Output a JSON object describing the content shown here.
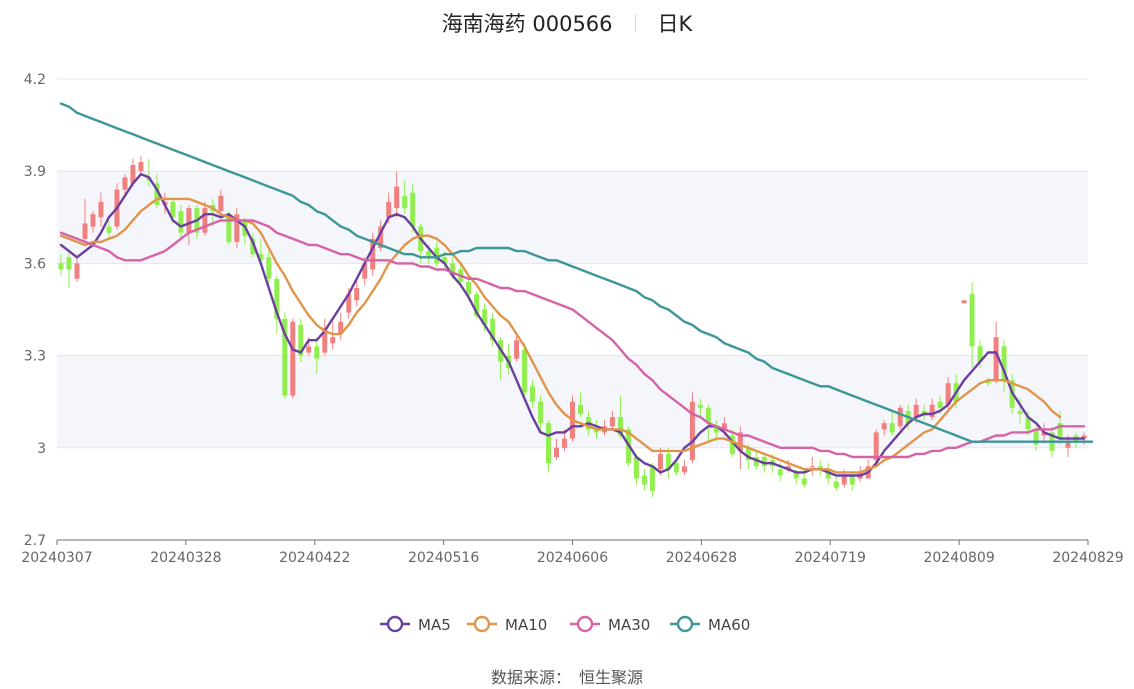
{
  "title": {
    "name": "海南海药 000566",
    "period": "日K"
  },
  "source": {
    "label": "数据来源：",
    "value": "恒生聚源"
  },
  "colors": {
    "up": "#f08080",
    "down": "#90ee50",
    "MA5": "#6a3fa0",
    "MA10": "#e0954a",
    "MA30": "#d663a8",
    "MA60": "#3d9698",
    "bandA": "#f4f6fb",
    "bandB": "#ffffff",
    "grid": "#e0e6f1"
  },
  "chart_data": {
    "type": "candlestick",
    "title": "海南海药 000566",
    "subtitle": "日K",
    "ylim": [
      2.7,
      4.2
    ],
    "yticks": [
      "2.7",
      "3",
      "3.3",
      "3.6",
      "3.9",
      "4.2"
    ],
    "xticks": [
      "20240307",
      "20240328",
      "20240422",
      "20240516",
      "20240606",
      "20240628",
      "20240719",
      "20240809",
      "20240829"
    ],
    "legend": [
      "MA5",
      "MA10",
      "MA30",
      "MA60"
    ],
    "legend_position": "bottom-center",
    "candles_ohlc": [
      [
        3.6,
        3.58,
        3.63,
        3.56
      ],
      [
        3.62,
        3.58,
        3.64,
        3.52
      ],
      [
        3.55,
        3.6,
        3.62,
        3.54
      ],
      [
        3.68,
        3.73,
        3.81,
        3.67
      ],
      [
        3.72,
        3.76,
        3.77,
        3.7
      ],
      [
        3.75,
        3.8,
        3.83,
        3.72
      ],
      [
        3.72,
        3.7,
        3.74,
        3.68
      ],
      [
        3.72,
        3.84,
        3.86,
        3.71
      ],
      [
        3.84,
        3.88,
        3.89,
        3.82
      ],
      [
        3.86,
        3.92,
        3.94,
        3.85
      ],
      [
        3.9,
        3.93,
        3.95,
        3.89
      ],
      [
        3.88,
        3.87,
        3.94,
        3.85
      ],
      [
        3.86,
        3.79,
        3.89,
        3.78
      ],
      [
        3.79,
        3.8,
        3.83,
        3.76
      ],
      [
        3.8,
        3.75,
        3.81,
        3.73
      ],
      [
        3.77,
        3.7,
        3.79,
        3.68
      ],
      [
        3.7,
        3.78,
        3.79,
        3.66
      ],
      [
        3.78,
        3.7,
        3.79,
        3.68
      ],
      [
        3.7,
        3.78,
        3.8,
        3.69
      ],
      [
        3.79,
        3.77,
        3.81,
        3.72
      ],
      [
        3.77,
        3.82,
        3.84,
        3.75
      ],
      [
        3.75,
        3.67,
        3.77,
        3.66
      ],
      [
        3.67,
        3.76,
        3.78,
        3.65
      ],
      [
        3.74,
        3.69,
        3.75,
        3.66
      ],
      [
        3.68,
        3.63,
        3.7,
        3.62
      ],
      [
        3.63,
        3.61,
        3.68,
        3.59
      ],
      [
        3.62,
        3.55,
        3.64,
        3.53
      ],
      [
        3.55,
        3.42,
        3.56,
        3.37
      ],
      [
        3.42,
        3.17,
        3.44,
        3.16
      ],
      [
        3.17,
        3.41,
        3.42,
        3.16
      ],
      [
        3.4,
        3.3,
        3.42,
        3.28
      ],
      [
        3.31,
        3.33,
        3.36,
        3.3
      ],
      [
        3.33,
        3.29,
        3.36,
        3.24
      ],
      [
        3.31,
        3.39,
        3.42,
        3.3
      ],
      [
        3.34,
        3.36,
        3.41,
        3.32
      ],
      [
        3.37,
        3.41,
        3.44,
        3.35
      ],
      [
        3.44,
        3.5,
        3.52,
        3.42
      ],
      [
        3.48,
        3.52,
        3.55,
        3.46
      ],
      [
        3.55,
        3.6,
        3.62,
        3.53
      ],
      [
        3.58,
        3.68,
        3.7,
        3.56
      ],
      [
        3.65,
        3.72,
        3.74,
        3.64
      ],
      [
        3.75,
        3.8,
        3.83,
        3.73
      ],
      [
        3.78,
        3.85,
        3.9,
        3.75
      ],
      [
        3.82,
        3.78,
        3.87,
        3.76
      ],
      [
        3.83,
        3.72,
        3.86,
        3.7
      ],
      [
        3.72,
        3.64,
        3.73,
        3.6
      ],
      [
        3.64,
        3.62,
        3.66,
        3.6
      ],
      [
        3.65,
        3.6,
        3.67,
        3.59
      ],
      [
        3.62,
        3.6,
        3.64,
        3.58
      ],
      [
        3.6,
        3.56,
        3.62,
        3.55
      ],
      [
        3.58,
        3.54,
        3.6,
        3.52
      ],
      [
        3.54,
        3.5,
        3.55,
        3.48
      ],
      [
        3.5,
        3.43,
        3.51,
        3.42
      ],
      [
        3.45,
        3.4,
        3.47,
        3.38
      ],
      [
        3.42,
        3.35,
        3.44,
        3.33
      ],
      [
        3.35,
        3.28,
        3.36,
        3.22
      ],
      [
        3.3,
        3.26,
        3.34,
        3.24
      ],
      [
        3.29,
        3.35,
        3.37,
        3.28
      ],
      [
        3.32,
        3.18,
        3.34,
        3.16
      ],
      [
        3.2,
        3.15,
        3.22,
        3.13
      ],
      [
        3.15,
        3.08,
        3.17,
        3.06
      ],
      [
        3.08,
        2.95,
        3.09,
        2.92
      ],
      [
        2.97,
        3.0,
        3.03,
        2.96
      ],
      [
        3.0,
        3.03,
        3.06,
        2.99
      ],
      [
        3.03,
        3.15,
        3.17,
        3.02
      ],
      [
        3.14,
        3.11,
        3.18,
        3.1
      ],
      [
        3.1,
        3.06,
        3.12,
        3.04
      ],
      [
        3.06,
        3.05,
        3.09,
        3.03
      ],
      [
        3.05,
        3.07,
        3.09,
        3.04
      ],
      [
        3.07,
        3.1,
        3.12,
        3.06
      ],
      [
        3.1,
        3.04,
        3.17,
        3.03
      ],
      [
        3.06,
        2.95,
        3.07,
        2.94
      ],
      [
        2.97,
        2.9,
        2.98,
        2.88
      ],
      [
        2.91,
        2.88,
        2.93,
        2.86
      ],
      [
        2.94,
        2.86,
        2.95,
        2.84
      ],
      [
        2.93,
        2.98,
        3.0,
        2.91
      ],
      [
        2.98,
        2.93,
        3.0,
        2.9
      ],
      [
        2.95,
        2.92,
        2.96,
        2.91
      ],
      [
        2.92,
        2.94,
        2.96,
        2.91
      ],
      [
        2.96,
        3.15,
        3.18,
        2.95
      ],
      [
        3.14,
        3.13,
        3.16,
        3.1
      ],
      [
        3.13,
        3.08,
        3.14,
        3.02
      ],
      [
        3.07,
        3.05,
        3.09,
        3.02
      ],
      [
        3.06,
        3.08,
        3.1,
        3.04
      ],
      [
        3.04,
        2.98,
        3.06,
        2.97
      ],
      [
        2.99,
        3.05,
        3.07,
        2.93
      ],
      [
        3.0,
        2.96,
        3.01,
        2.93
      ],
      [
        2.97,
        2.94,
        2.99,
        2.93
      ],
      [
        2.97,
        2.94,
        2.98,
        2.92
      ],
      [
        2.96,
        2.94,
        2.98,
        2.92
      ],
      [
        2.93,
        2.91,
        2.95,
        2.89
      ],
      [
        2.93,
        2.94,
        2.96,
        2.92
      ],
      [
        2.92,
        2.9,
        2.93,
        2.88
      ],
      [
        2.9,
        2.88,
        2.93,
        2.87
      ],
      [
        2.94,
        2.94,
        2.97,
        2.91
      ],
      [
        2.94,
        2.93,
        2.96,
        2.91
      ],
      [
        2.93,
        2.9,
        2.95,
        2.88
      ],
      [
        2.89,
        2.87,
        2.91,
        2.86
      ],
      [
        2.88,
        2.91,
        2.93,
        2.87
      ],
      [
        2.91,
        2.88,
        2.92,
        2.86
      ],
      [
        2.9,
        2.92,
        2.94,
        2.89
      ],
      [
        2.9,
        2.94,
        2.96,
        2.9
      ],
      [
        2.96,
        3.05,
        3.06,
        2.94
      ],
      [
        3.06,
        3.08,
        3.09,
        3.04
      ],
      [
        3.08,
        3.05,
        3.12,
        3.04
      ],
      [
        3.07,
        3.13,
        3.14,
        3.06
      ],
      [
        3.12,
        3.08,
        3.14,
        3.06
      ],
      [
        3.1,
        3.14,
        3.16,
        3.08
      ],
      [
        3.12,
        3.11,
        3.14,
        3.09
      ],
      [
        3.1,
        3.14,
        3.16,
        3.09
      ],
      [
        3.15,
        3.13,
        3.17,
        3.11
      ],
      [
        3.14,
        3.21,
        3.23,
        3.12
      ],
      [
        3.21,
        3.15,
        3.24,
        3.13
      ],
      [
        3.47,
        3.48,
        3.48,
        3.47
      ],
      [
        3.5,
        3.33,
        3.54,
        3.26
      ],
      [
        3.33,
        3.28,
        3.35,
        3.26
      ],
      [
        3.22,
        3.21,
        3.23,
        3.2
      ],
      [
        3.22,
        3.36,
        3.41,
        3.21
      ],
      [
        3.33,
        3.22,
        3.35,
        3.18
      ],
      [
        3.22,
        3.13,
        3.24,
        3.11
      ],
      [
        3.12,
        3.11,
        3.16,
        3.08
      ],
      [
        3.1,
        3.06,
        3.12,
        3.04
      ],
      [
        3.06,
        3.01,
        3.07,
        2.99
      ],
      [
        3.04,
        3.05,
        3.08,
        3.02
      ],
      [
        3.05,
        2.99,
        3.07,
        2.97
      ],
      [
        3.08,
        3.03,
        3.12,
        3.01
      ],
      [
        3.0,
        3.02,
        3.04,
        2.97
      ],
      [
        3.04,
        3.02,
        3.05,
        3.0
      ],
      [
        3.03,
        3.04,
        3.05,
        3.01
      ]
    ],
    "series": [
      {
        "name": "MA5",
        "values": [
          3.66,
          3.64,
          3.62,
          3.64,
          3.66,
          3.7,
          3.75,
          3.78,
          3.82,
          3.86,
          3.89,
          3.88,
          3.84,
          3.79,
          3.74,
          3.72,
          3.73,
          3.74,
          3.76,
          3.76,
          3.75,
          3.76,
          3.74,
          3.72,
          3.67,
          3.6,
          3.52,
          3.44,
          3.37,
          3.32,
          3.31,
          3.35,
          3.35,
          3.38,
          3.42,
          3.46,
          3.5,
          3.55,
          3.6,
          3.65,
          3.7,
          3.75,
          3.76,
          3.75,
          3.72,
          3.68,
          3.65,
          3.62,
          3.6,
          3.56,
          3.53,
          3.49,
          3.44,
          3.4,
          3.36,
          3.32,
          3.28,
          3.22,
          3.16,
          3.1,
          3.05,
          3.04,
          3.05,
          3.05,
          3.07,
          3.07,
          3.08,
          3.07,
          3.06,
          3.06,
          3.05,
          3.01,
          2.97,
          2.95,
          2.94,
          2.92,
          2.93,
          2.96,
          3.0,
          3.02,
          3.05,
          3.07,
          3.07,
          3.05,
          3.02,
          2.99,
          2.97,
          2.96,
          2.95,
          2.95,
          2.94,
          2.93,
          2.92,
          2.92,
          2.93,
          2.93,
          2.92,
          2.91,
          2.91,
          2.91,
          2.91,
          2.92,
          2.95,
          2.99,
          3.02,
          3.05,
          3.08,
          3.1,
          3.11,
          3.11,
          3.12,
          3.14,
          3.18,
          3.22,
          3.25,
          3.28,
          3.31,
          3.31,
          3.25,
          3.18,
          3.14,
          3.1,
          3.08,
          3.05,
          3.04,
          3.03,
          3.03,
          3.03,
          3.03
        ]
      },
      {
        "name": "MA10",
        "values": [
          3.69,
          3.68,
          3.67,
          3.66,
          3.67,
          3.67,
          3.68,
          3.69,
          3.71,
          3.74,
          3.77,
          3.79,
          3.81,
          3.81,
          3.81,
          3.81,
          3.81,
          3.8,
          3.79,
          3.78,
          3.76,
          3.75,
          3.74,
          3.74,
          3.73,
          3.7,
          3.65,
          3.6,
          3.56,
          3.51,
          3.47,
          3.43,
          3.4,
          3.38,
          3.37,
          3.37,
          3.4,
          3.44,
          3.47,
          3.51,
          3.55,
          3.6,
          3.63,
          3.66,
          3.68,
          3.69,
          3.69,
          3.68,
          3.66,
          3.63,
          3.6,
          3.56,
          3.53,
          3.49,
          3.46,
          3.43,
          3.41,
          3.37,
          3.33,
          3.28,
          3.23,
          3.18,
          3.14,
          3.11,
          3.09,
          3.08,
          3.07,
          3.06,
          3.06,
          3.06,
          3.06,
          3.05,
          3.03,
          3.01,
          2.99,
          2.99,
          2.99,
          2.99,
          2.99,
          3.0,
          3.01,
          3.02,
          3.03,
          3.03,
          3.02,
          3.01,
          3.0,
          2.99,
          2.98,
          2.97,
          2.96,
          2.95,
          2.94,
          2.93,
          2.93,
          2.93,
          2.93,
          2.92,
          2.92,
          2.92,
          2.92,
          2.93,
          2.94,
          2.96,
          2.97,
          2.99,
          3.01,
          3.03,
          3.05,
          3.06,
          3.09,
          3.12,
          3.15,
          3.17,
          3.19,
          3.21,
          3.22,
          3.22,
          3.22,
          3.21,
          3.2,
          3.19,
          3.17,
          3.15,
          3.12,
          3.1
        ]
      },
      {
        "name": "MA30",
        "values": [
          3.7,
          3.69,
          3.68,
          3.67,
          3.66,
          3.65,
          3.64,
          3.62,
          3.61,
          3.61,
          3.61,
          3.62,
          3.63,
          3.64,
          3.66,
          3.68,
          3.7,
          3.71,
          3.72,
          3.73,
          3.74,
          3.74,
          3.74,
          3.74,
          3.74,
          3.73,
          3.72,
          3.7,
          3.69,
          3.68,
          3.67,
          3.66,
          3.66,
          3.65,
          3.64,
          3.63,
          3.63,
          3.62,
          3.61,
          3.61,
          3.61,
          3.61,
          3.6,
          3.6,
          3.6,
          3.59,
          3.59,
          3.58,
          3.58,
          3.57,
          3.56,
          3.55,
          3.55,
          3.54,
          3.53,
          3.52,
          3.52,
          3.51,
          3.51,
          3.5,
          3.49,
          3.48,
          3.47,
          3.46,
          3.45,
          3.43,
          3.41,
          3.39,
          3.37,
          3.35,
          3.32,
          3.29,
          3.27,
          3.24,
          3.22,
          3.19,
          3.17,
          3.15,
          3.13,
          3.11,
          3.1,
          3.08,
          3.07,
          3.06,
          3.05,
          3.04,
          3.04,
          3.03,
          3.02,
          3.01,
          3.0,
          3.0,
          3.0,
          3.0,
          3.0,
          2.99,
          2.99,
          2.98,
          2.98,
          2.97,
          2.97,
          2.97,
          2.97,
          2.97,
          2.97,
          2.97,
          2.97,
          2.98,
          2.98,
          2.99,
          2.99,
          3.0,
          3.0,
          3.01,
          3.02,
          3.02,
          3.03,
          3.04,
          3.04,
          3.05,
          3.05,
          3.05,
          3.06,
          3.06,
          3.06,
          3.07,
          3.07,
          3.07,
          3.07
        ]
      },
      {
        "name": "MA60",
        "values": [
          4.12,
          4.11,
          4.09,
          4.08,
          4.07,
          4.06,
          4.05,
          4.04,
          4.03,
          4.02,
          4.01,
          4.0,
          3.99,
          3.98,
          3.97,
          3.96,
          3.95,
          3.94,
          3.93,
          3.92,
          3.91,
          3.9,
          3.89,
          3.88,
          3.87,
          3.86,
          3.85,
          3.84,
          3.83,
          3.82,
          3.8,
          3.79,
          3.77,
          3.76,
          3.74,
          3.72,
          3.71,
          3.69,
          3.68,
          3.67,
          3.66,
          3.65,
          3.64,
          3.63,
          3.63,
          3.62,
          3.62,
          3.62,
          3.63,
          3.63,
          3.64,
          3.64,
          3.65,
          3.65,
          3.65,
          3.65,
          3.65,
          3.64,
          3.64,
          3.63,
          3.62,
          3.61,
          3.61,
          3.6,
          3.59,
          3.58,
          3.57,
          3.56,
          3.55,
          3.54,
          3.53,
          3.52,
          3.51,
          3.49,
          3.48,
          3.46,
          3.45,
          3.43,
          3.41,
          3.4,
          3.38,
          3.37,
          3.36,
          3.34,
          3.33,
          3.32,
          3.31,
          3.29,
          3.28,
          3.26,
          3.25,
          3.24,
          3.23,
          3.22,
          3.21,
          3.2,
          3.2,
          3.19,
          3.18,
          3.17,
          3.16,
          3.15,
          3.14,
          3.13,
          3.12,
          3.11,
          3.1,
          3.09,
          3.08,
          3.07,
          3.06,
          3.05,
          3.04,
          3.03,
          3.02,
          3.02,
          3.02,
          3.02,
          3.02,
          3.02,
          3.02,
          3.02,
          3.02,
          3.02,
          3.02,
          3.02,
          3.02,
          3.02,
          3.02,
          3.02
        ]
      }
    ]
  }
}
